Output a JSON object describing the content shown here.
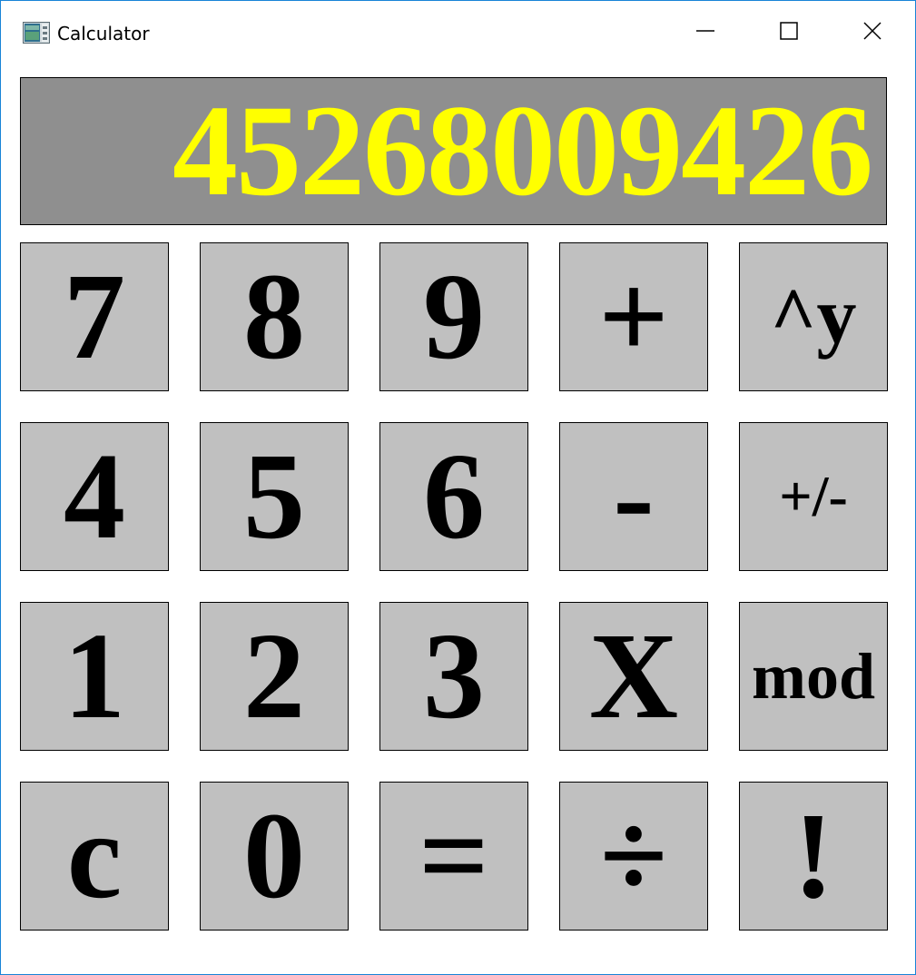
{
  "window": {
    "title": "Calculator",
    "icon": "calculator-app-icon",
    "controls": {
      "minimize": "minimize-icon",
      "maximize": "maximize-icon",
      "close": "close-icon"
    }
  },
  "display": {
    "value": "45268009426",
    "background_color": "#8f8f8f",
    "text_color": "#ffff00"
  },
  "keys": {
    "row1": [
      "7",
      "8",
      "9",
      "+",
      "^y"
    ],
    "row2": [
      "4",
      "5",
      "6",
      "-",
      "+/-"
    ],
    "row3": [
      "1",
      "2",
      "3",
      "X",
      "mod"
    ],
    "row4": [
      "c",
      "0",
      "=",
      "÷",
      "!"
    ]
  },
  "key_color": "#c0c0c0"
}
